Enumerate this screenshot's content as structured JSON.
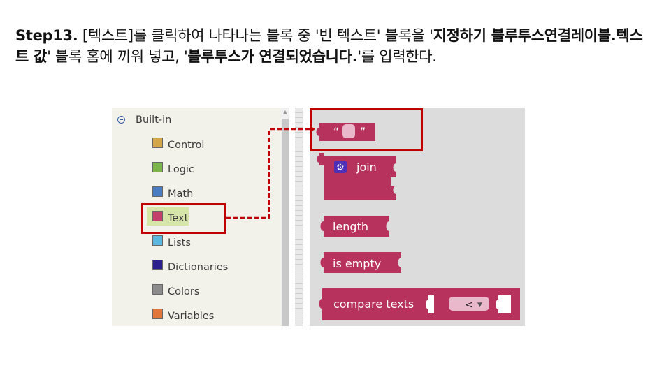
{
  "instruction": {
    "step": "Step13.",
    "text1": " [텍스트]를 클릭하여 나타나는 블록 중 '빈 텍스트' 블록을 '",
    "bold1": "지정하기 블루투스연결레이블.텍스트 값",
    "text2": "' 블록 홈에 끼워 넣고, '",
    "bold2": "블루투스가 연결되었습니다.",
    "text3": "'를 입력한다."
  },
  "palette": {
    "root": {
      "icon": "collapse-minus-icon",
      "label": "Built-in"
    },
    "items": [
      {
        "label": "Control",
        "color": "#d4a64a"
      },
      {
        "label": "Logic",
        "color": "#7bb54c"
      },
      {
        "label": "Math",
        "color": "#4a7cc2"
      },
      {
        "label": "Text",
        "color": "#c2406a",
        "selected": true
      },
      {
        "label": "Lists",
        "color": "#5ab8e0"
      },
      {
        "label": "Dictionaries",
        "color": "#2a1f8c"
      },
      {
        "label": "Colors",
        "color": "#8c8c8c"
      },
      {
        "label": "Variables",
        "color": "#e0763a"
      }
    ],
    "selected_bg": "#d6e6a8"
  },
  "blocks": {
    "color": "#b8325e",
    "empty_text": {
      "open_quote": "“",
      "close_quote": "”"
    },
    "join": {
      "label": "join",
      "icon": "gear-icon"
    },
    "length": {
      "label": "length"
    },
    "is_empty": {
      "label": "is empty"
    },
    "compare": {
      "label": "compare texts",
      "operator": "<",
      "dropdown_icon": "chevron-down-icon"
    }
  },
  "annotation_color": "#c00000"
}
